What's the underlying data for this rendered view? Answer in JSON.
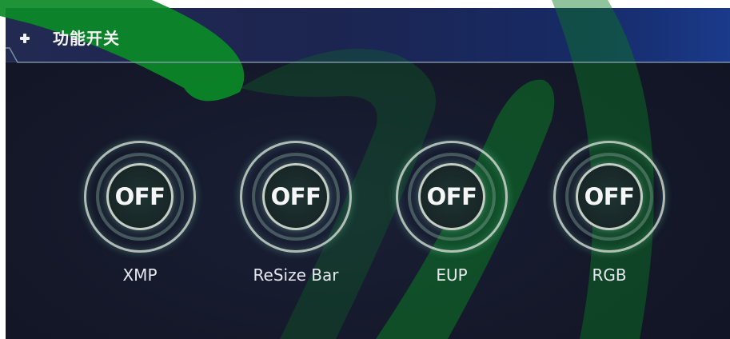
{
  "panel": {
    "title": "功能开关",
    "title_icon": "plus-icon"
  },
  "switches": [
    {
      "state": "OFF",
      "label": "XMP"
    },
    {
      "state": "OFF",
      "label": "ReSize Bar"
    },
    {
      "state": "OFF",
      "label": "EUP"
    },
    {
      "state": "OFF",
      "label": "RGB"
    }
  ],
  "colors": {
    "panel_bg": "#141829",
    "header_bg": "#1c2550",
    "ring": "#cdd7cd",
    "watermark_green": "#0d9a2a"
  }
}
